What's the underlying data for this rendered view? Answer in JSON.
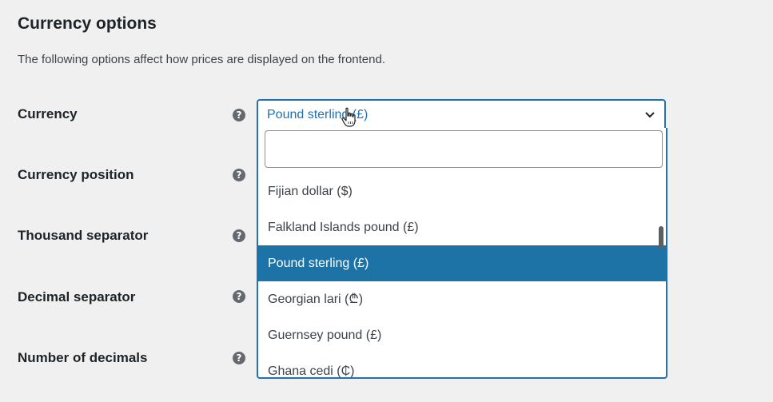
{
  "section": {
    "title": "Currency options",
    "description": "The following options affect how prices are displayed on the frontend."
  },
  "rows": [
    {
      "label": "Currency"
    },
    {
      "label": "Currency position"
    },
    {
      "label": "Thousand separator"
    },
    {
      "label": "Decimal separator"
    },
    {
      "label": "Number of decimals"
    }
  ],
  "help_icon_glyph": "?",
  "currency_select": {
    "value": "Pound sterling (£)",
    "search_value": "",
    "options": [
      "Fijian dollar ($)",
      "Falkland Islands pound (£)",
      "Pound sterling (£)",
      "Georgian lari (₾)",
      "Guernsey pound (£)",
      "Ghana cedi (₵)"
    ],
    "highlighted_index": 2
  },
  "colors": {
    "accent": "#2271b1",
    "highlight": "#1e73a6",
    "background": "#f0f0f1"
  },
  "icons": {
    "help": "question-mark-circle-icon",
    "dropdown": "chevron-down-icon",
    "cursor": "hand-pointer-icon"
  }
}
